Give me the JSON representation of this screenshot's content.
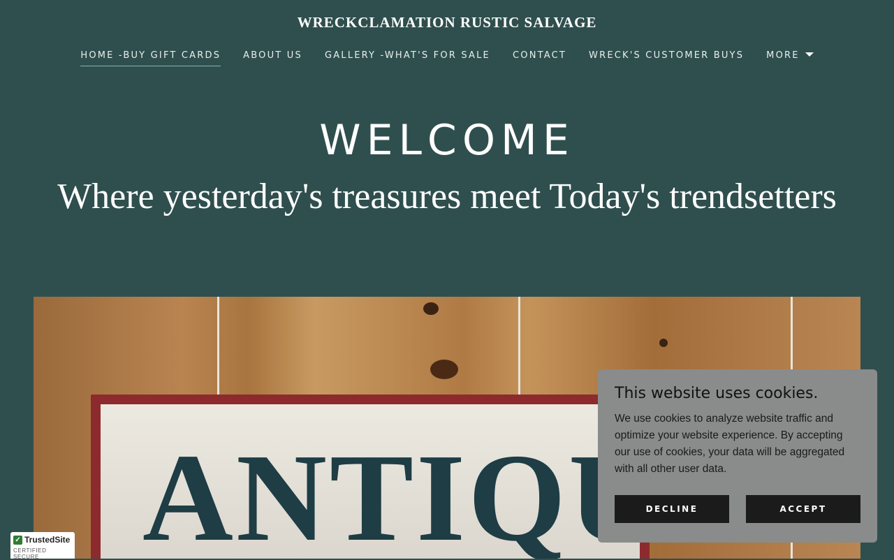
{
  "header": {
    "site_title": "WRECKCLAMATION RUSTIC SALVAGE"
  },
  "nav": {
    "items": [
      {
        "label": "HOME -BUY GIFT CARDS"
      },
      {
        "label": "ABOUT US"
      },
      {
        "label": "GALLERY -WHAT'S FOR SALE"
      },
      {
        "label": "CONTACT"
      },
      {
        "label": "WRECK'S CUSTOMER BUYS"
      },
      {
        "label": "MORE"
      }
    ],
    "active": "HOME -BUY GIFT CARDS"
  },
  "hero": {
    "heading": "WELCOME",
    "subheading": "Where yesterday's treasures meet Today's trendsetters",
    "image_sign_text": "ANTIQUES"
  },
  "cookie_banner": {
    "title": "This website uses cookies.",
    "body": "We use cookies to analyze website traffic and optimize your website experience. By accepting our use of cookies, your data will be aggregated with all other user data.",
    "decline_label": "DECLINE",
    "accept_label": "ACCEPT"
  },
  "trust_badge": {
    "name": "TrustedSite",
    "caption": "CERTIFIED SECURE"
  },
  "colors": {
    "background": "#2f4f4e",
    "active_underline": "#7fb9b6",
    "cookie_panel": "#8a8b8b",
    "button": "#1b1b1b"
  }
}
